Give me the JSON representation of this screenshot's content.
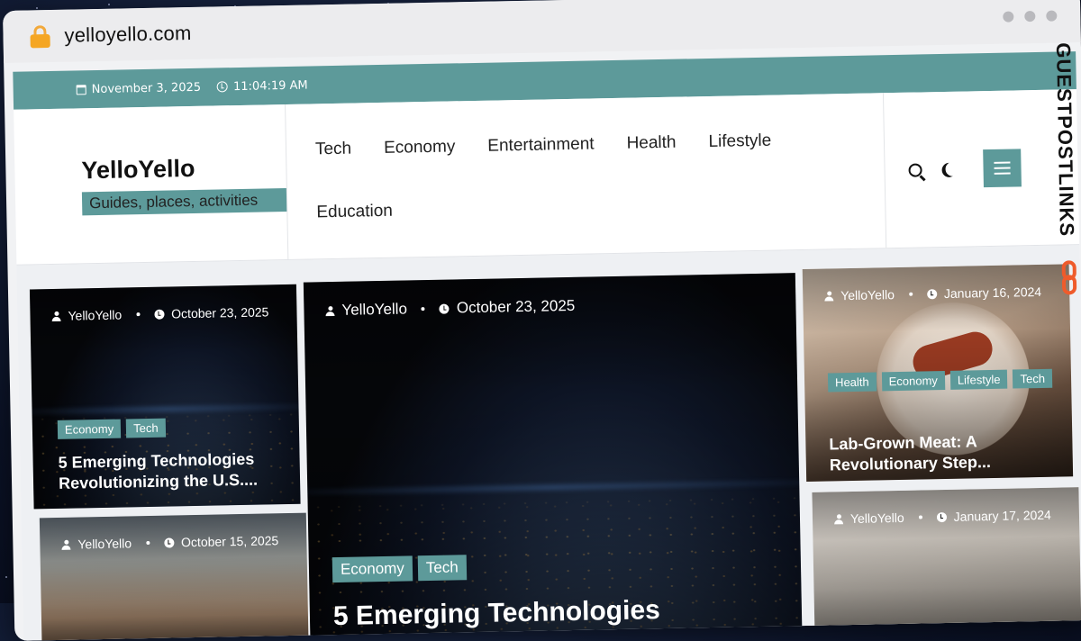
{
  "browser": {
    "url": "yelloyello.com"
  },
  "topbar": {
    "date": "November 3, 2025",
    "time": "11:04:19 AM"
  },
  "brand": {
    "name": "YelloYello",
    "tagline": "Guides, places, activities"
  },
  "nav": [
    "Tech",
    "Economy",
    "Entertainment",
    "Health",
    "Lifestyle",
    "Education"
  ],
  "watermark": "GUESTPOSTLINKS",
  "cards": {
    "left_top": {
      "author": "YelloYello",
      "date": "October 23, 2025",
      "tags": [
        "Economy",
        "Tech"
      ],
      "title": "5 Emerging Technologies Revolutionizing the U.S...."
    },
    "left_bottom": {
      "author": "YelloYello",
      "date": "October 15, 2025"
    },
    "center": {
      "author": "YelloYello",
      "date": "October 23, 2025",
      "tags": [
        "Economy",
        "Tech"
      ],
      "title": "5 Emerging Technologies"
    },
    "right_top": {
      "author": "YelloYello",
      "date": "January 16, 2024",
      "tags": [
        "Health",
        "Economy",
        "Lifestyle",
        "Tech"
      ],
      "title": "Lab-Grown Meat: A Revolutionary Step..."
    },
    "right_bottom": {
      "author": "YelloYello",
      "date": "January 17, 2024"
    }
  }
}
